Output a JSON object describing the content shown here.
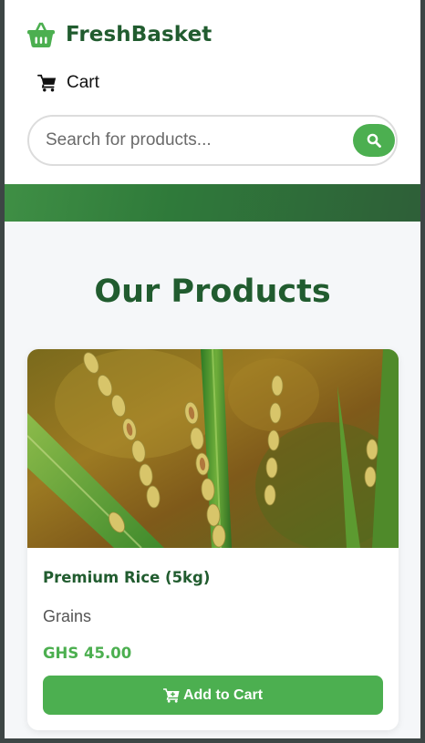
{
  "app": {
    "brand_name": "FreshBasket",
    "brand_icon": "basket-icon",
    "accent_color": "#4caf50",
    "brand_color": "#215c2f"
  },
  "nav": {
    "cart_label": "Cart",
    "cart_icon": "shopping-cart-icon"
  },
  "search": {
    "placeholder": "Search for products...",
    "value": "",
    "button_icon": "search-icon"
  },
  "main": {
    "section_title": "Our Products",
    "products": [
      {
        "name": "Premium Rice (5kg)",
        "category": "Grains",
        "price": "GHS 45.00",
        "image_subject": "rice plants in a field",
        "button_label": "Add to Cart",
        "button_icon": "cart-plus-icon"
      }
    ]
  }
}
